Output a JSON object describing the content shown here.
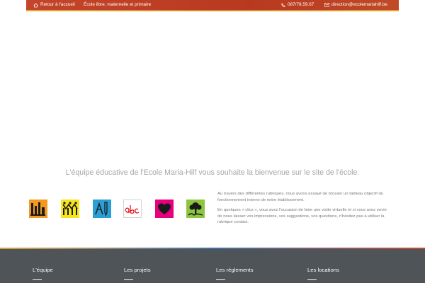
{
  "topbar": {
    "home_label": "Retour à l'accueil",
    "tagline": "École libre, maternelle et primaire",
    "phone": "087/78.59.67",
    "email": "direction@ecolemariahilf.be",
    "icons": {
      "home": "home-icon",
      "phone": "phone-icon",
      "email": "mail-icon"
    }
  },
  "main": {
    "welcome": "L'équipe éducative de l'Ecole Maria-Hilf vous souhaite la bienvenue sur le site de l'école.",
    "intro": [
      "Au travers des différentes rubriques, nous avons essayé de brosser un tableau objectif du fonctionnement interne de notre établissement.",
      "En quelques « clics », vous avez l'occasion de faire une visite virtuelle et si vous avez envie de nous laisser vos impressions, vos suggestions, vos questions, n'hésitez pas à utiliser la rubrique contact."
    ],
    "logo_tiles": [
      {
        "name": "pencils-tile",
        "color": "#f29a1f"
      },
      {
        "name": "children-tile",
        "color": "#f6e51d"
      },
      {
        "name": "tools-tile",
        "color": "#2a9fd6"
      },
      {
        "name": "abc-tile",
        "color": "#ffffff"
      },
      {
        "name": "heart-tile",
        "color": "#e6007e"
      },
      {
        "name": "tree-tile",
        "color": "#8cc63f"
      }
    ]
  },
  "footer": {
    "columns": [
      {
        "label": "L'équipe"
      },
      {
        "label": "Les projets"
      },
      {
        "label": "Les règlements"
      },
      {
        "label": "Les locations"
      }
    ]
  },
  "colors": {
    "topbar": "#b8391f",
    "accent": "#e6a83a",
    "footer": "#4e5457",
    "welcome_text": "#a6a6a6"
  }
}
